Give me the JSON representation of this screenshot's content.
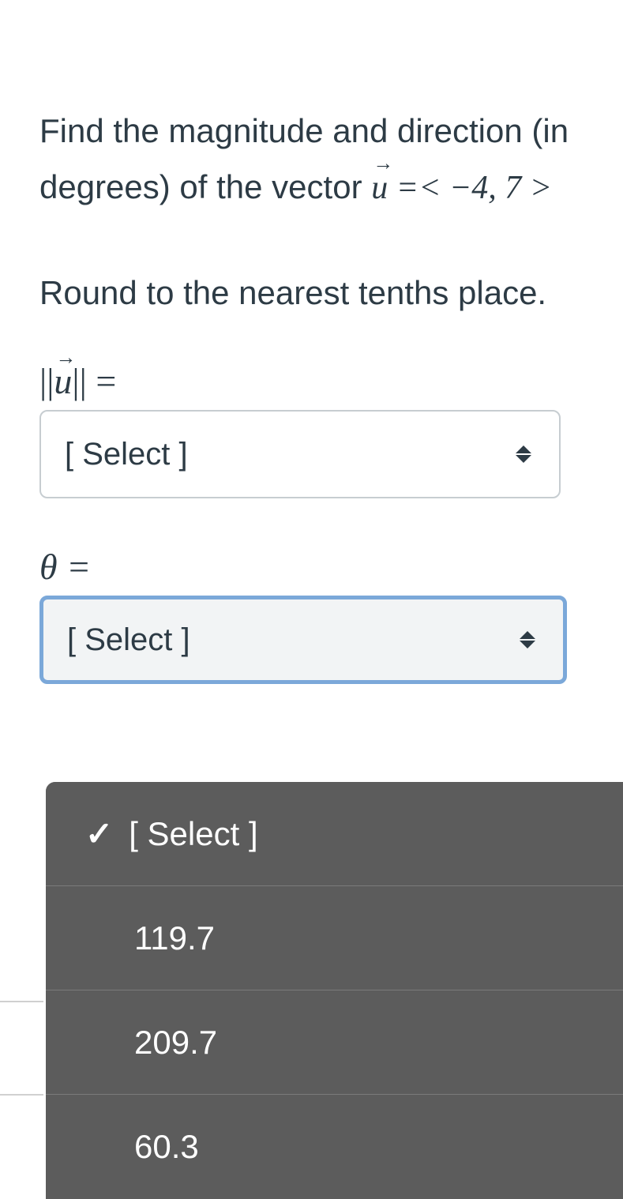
{
  "question": {
    "intro": "Find the magnitude and direction (in degrees) of the vector ",
    "vector_symbol": "u",
    "vector_value": " =< −4, 7 >",
    "instruction": "Round to the nearest tenths place."
  },
  "magnitude": {
    "label_prefix": "||",
    "label_symbol": "u",
    "label_suffix": "|| =",
    "placeholder": "[ Select ]"
  },
  "direction": {
    "label": "θ =",
    "placeholder": "[ Select ]"
  },
  "dropdown": {
    "options": [
      {
        "text": "[ Select ]",
        "selected": true
      },
      {
        "text": "119.7",
        "selected": false
      },
      {
        "text": "209.7",
        "selected": false
      },
      {
        "text": "60.3",
        "selected": false
      }
    ]
  }
}
